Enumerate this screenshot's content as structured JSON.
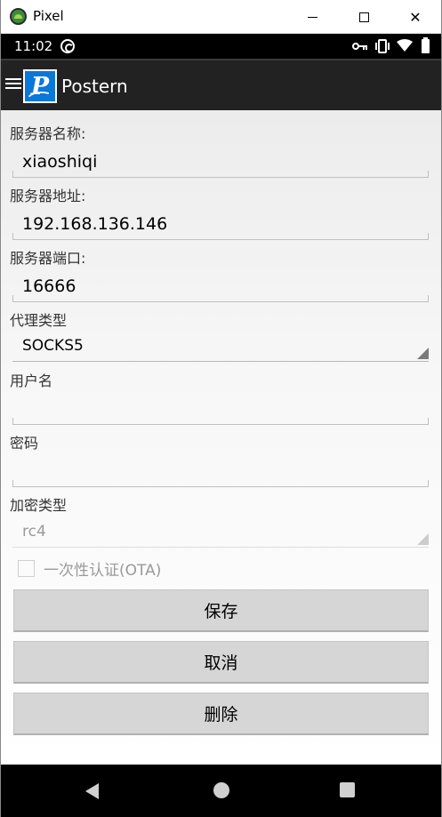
{
  "window": {
    "title": "Pixel",
    "close_symbol": "✕"
  },
  "status_bar": {
    "time": "11:02",
    "icons": [
      "sync-icon",
      "vpn-key-icon",
      "vibrate-icon",
      "wifi-icon",
      "battery-icon"
    ]
  },
  "action_bar": {
    "title": "Postern",
    "logo_letter": "P"
  },
  "form": {
    "server_name": {
      "label": "服务器名称:",
      "value": "xiaoshiqi"
    },
    "server_address": {
      "label": "服务器地址:",
      "value": "192.168.136.146"
    },
    "server_port": {
      "label": "服务器端口:",
      "value": "16666"
    },
    "proxy_type": {
      "label": "代理类型",
      "value": "SOCKS5"
    },
    "username": {
      "label": "用户名",
      "value": ""
    },
    "password": {
      "label": "密码",
      "value": ""
    },
    "encryption_type": {
      "label": "加密类型",
      "value": "rc4"
    },
    "ota": {
      "label": "一次性认证(OTA)",
      "checked": false
    }
  },
  "buttons": {
    "save": "保存",
    "cancel": "取消",
    "delete": "删除"
  },
  "nav_bar": {
    "icons": [
      "back-icon",
      "home-icon",
      "recents-icon"
    ]
  }
}
